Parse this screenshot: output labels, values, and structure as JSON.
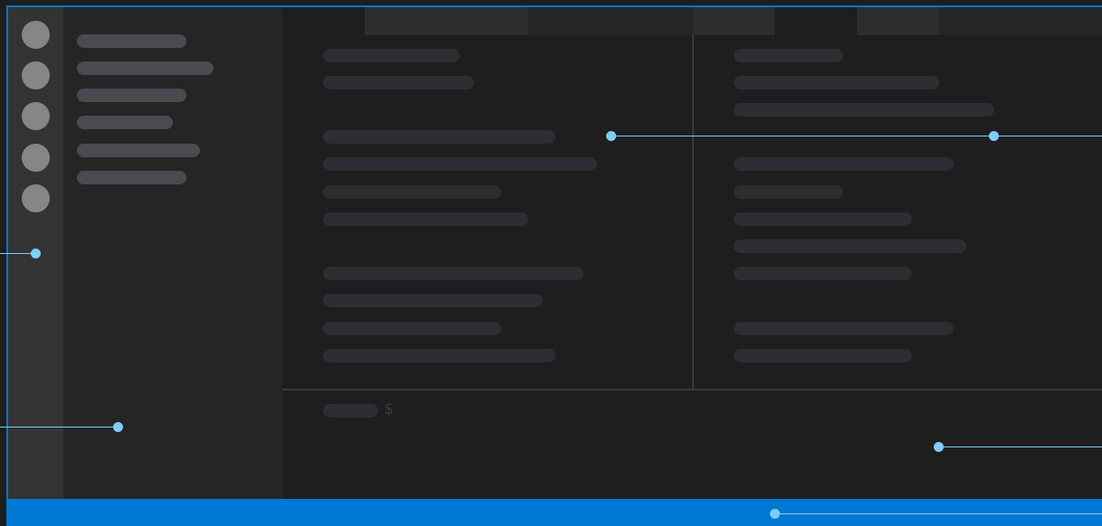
{
  "colors": {
    "accent": "#0078d4",
    "frame": "#0e74c4",
    "callout": "#7fcdf8",
    "activity_bar": "#333333",
    "sidebar": "#252526",
    "editor": "#1e1e1e"
  },
  "panel": {
    "prompt_symbol": "$"
  }
}
